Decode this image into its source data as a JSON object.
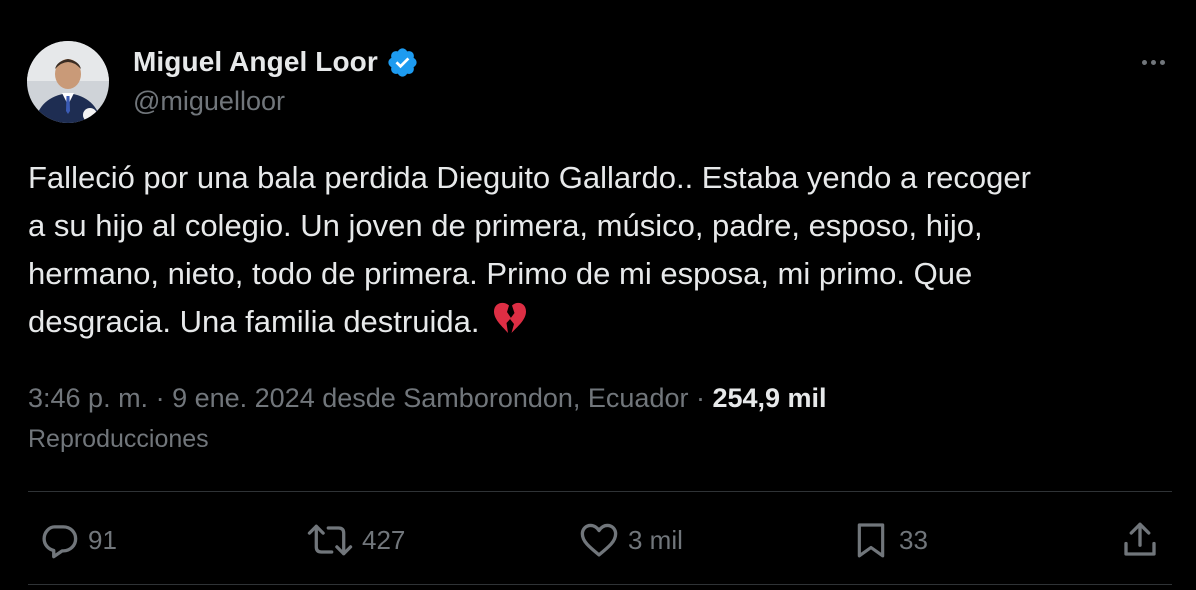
{
  "author": {
    "display_name": "Miguel Angel Loor",
    "handle": "@miguelloor",
    "verified_icon": "verified-badge-icon"
  },
  "tweet": {
    "lines": [
      "Falleció por una bala perdida Dieguito Gallardo.. Estaba yendo a recoger",
      "a su hijo al colegio. Un joven de primera, músico, padre, esposo, hijo,",
      "hermano, nieto, todo de primera. Primo de mi esposa, mi primo. Que",
      "desgracia. Una familia destruida."
    ],
    "emoji": "broken-heart-icon"
  },
  "meta": {
    "time": "3:46 p. m.",
    "sep1": " · ",
    "date": "9 ene. 2024",
    "location": " desde Samborondon, Ecuador",
    "sep2": " · ",
    "views_count": "254,9 mil",
    "views_label": "Reproducciones"
  },
  "actions": {
    "replies": "91",
    "retweets": "427",
    "likes": "3 mil",
    "bookmarks": "33"
  },
  "colors": {
    "background": "#000000",
    "text": "#e7e9ea",
    "secondary": "#71767b",
    "divider": "#2f3336",
    "verified": "#1d9bf0",
    "broken_heart": "#dd2e44"
  }
}
